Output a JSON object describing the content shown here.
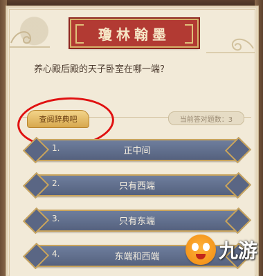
{
  "panel": {
    "title": "瓊林翰墨",
    "question": "养心殿后殿的天子卧室在哪一端？",
    "consult_button": "查阅辞典吧",
    "answer_count": "当前答对题数：3"
  },
  "options": [
    {
      "num": "1.",
      "label": "正中间"
    },
    {
      "num": "2.",
      "label": "只有西端"
    },
    {
      "num": "3.",
      "label": "只有东端"
    },
    {
      "num": "4.",
      "label": "东端和西端"
    }
  ],
  "watermark": {
    "text": "九游",
    "icon": "mascot-face-icon"
  },
  "colors": {
    "banner_red": "#b23a33",
    "option_blue": "#5a6684",
    "gold_trim": "#c9a45c",
    "annotation_red": "#e01111",
    "parchment": "#f2ead8"
  }
}
